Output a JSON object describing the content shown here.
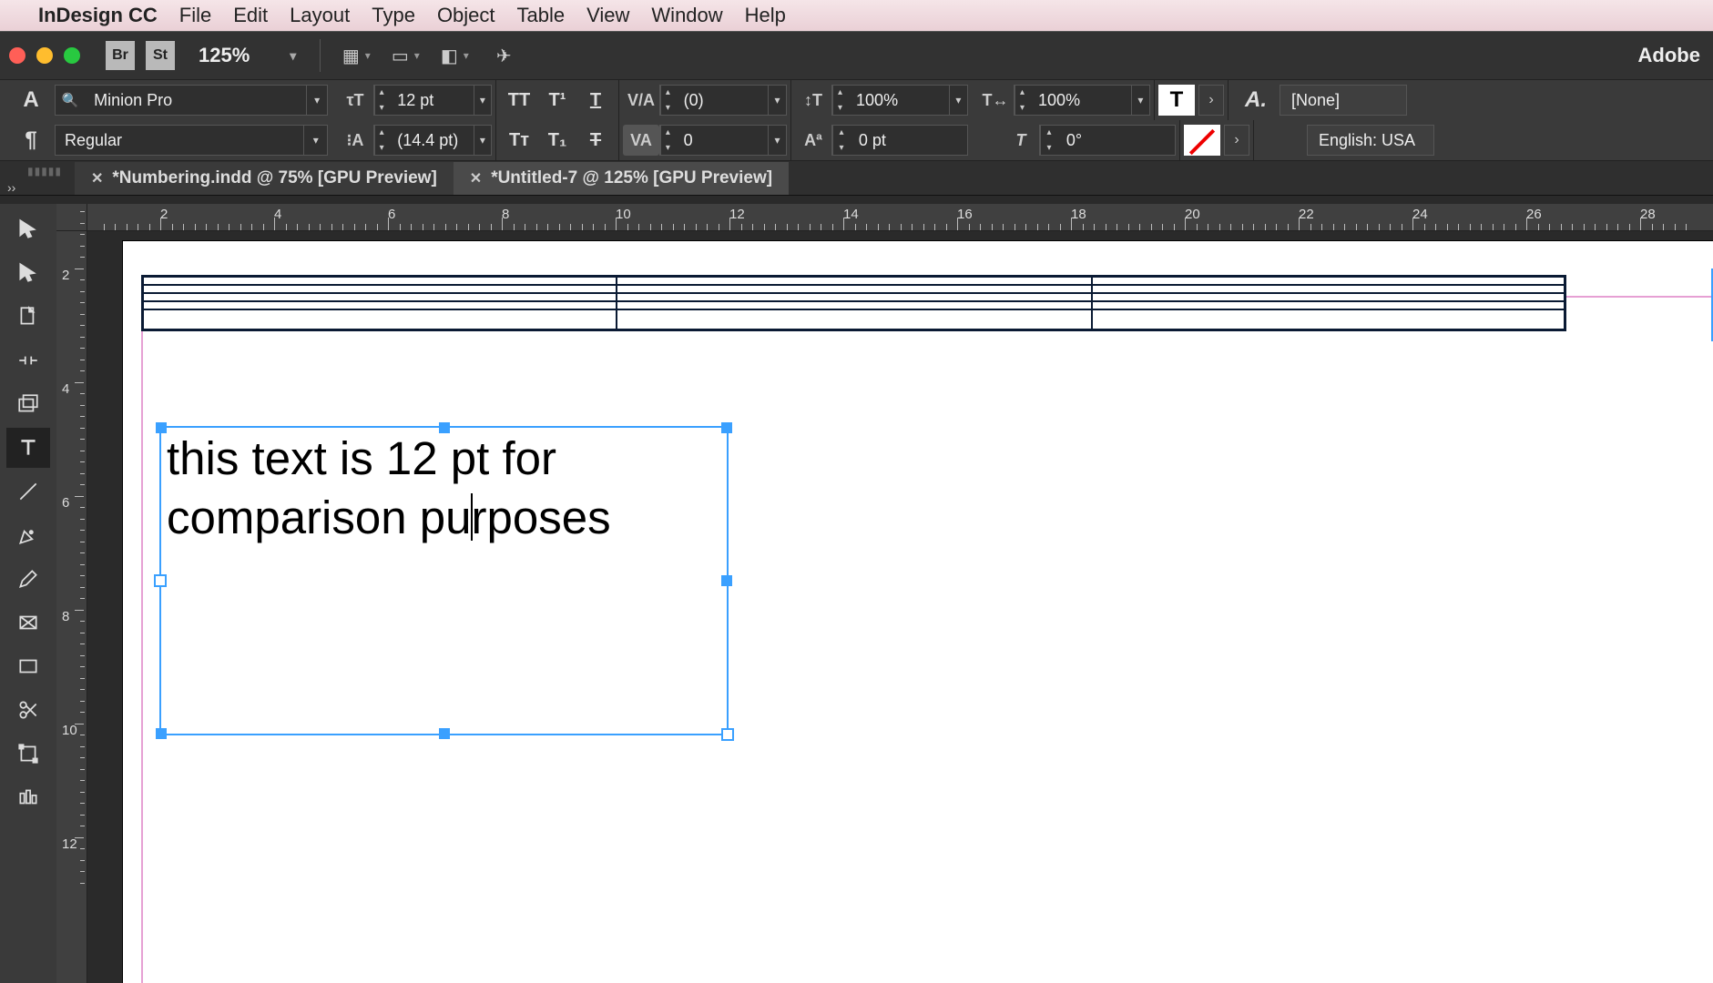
{
  "mac_menu": {
    "app_name": "InDesign CC",
    "items": [
      "File",
      "Edit",
      "Layout",
      "Type",
      "Object",
      "Table",
      "View",
      "Window",
      "Help"
    ]
  },
  "titlebar": {
    "btn_br": "Br",
    "btn_st": "St",
    "zoom": "125%",
    "brand": "Adobe"
  },
  "control": {
    "font_family": "Minion Pro",
    "font_style": "Regular",
    "font_size": "12 pt",
    "leading": "(14.4 pt)",
    "kerning": "(0)",
    "tracking": "0",
    "v_scale": "100%",
    "h_scale": "100%",
    "baseline": "0 pt",
    "skew": "0°",
    "char_style": "[None]",
    "language": "English: USA"
  },
  "tabs": [
    {
      "label": "*Numbering.indd @ 75% [GPU Preview]",
      "active": false
    },
    {
      "label": "*Untitled-7 @ 125% [GPU Preview]",
      "active": true
    }
  ],
  "h_ruler_nums": [
    "2",
    "4",
    "6",
    "8",
    "10",
    "12",
    "14",
    "16",
    "18",
    "20",
    "22",
    "24",
    "26",
    "28"
  ],
  "v_ruler_nums": [
    "2",
    "4",
    "6",
    "8",
    "10",
    "12"
  ],
  "document": {
    "text_frame_content_l1": "this text is 12 pt for",
    "text_frame_content_l2a": "comparison pu",
    "text_frame_content_l2b": "rposes"
  }
}
